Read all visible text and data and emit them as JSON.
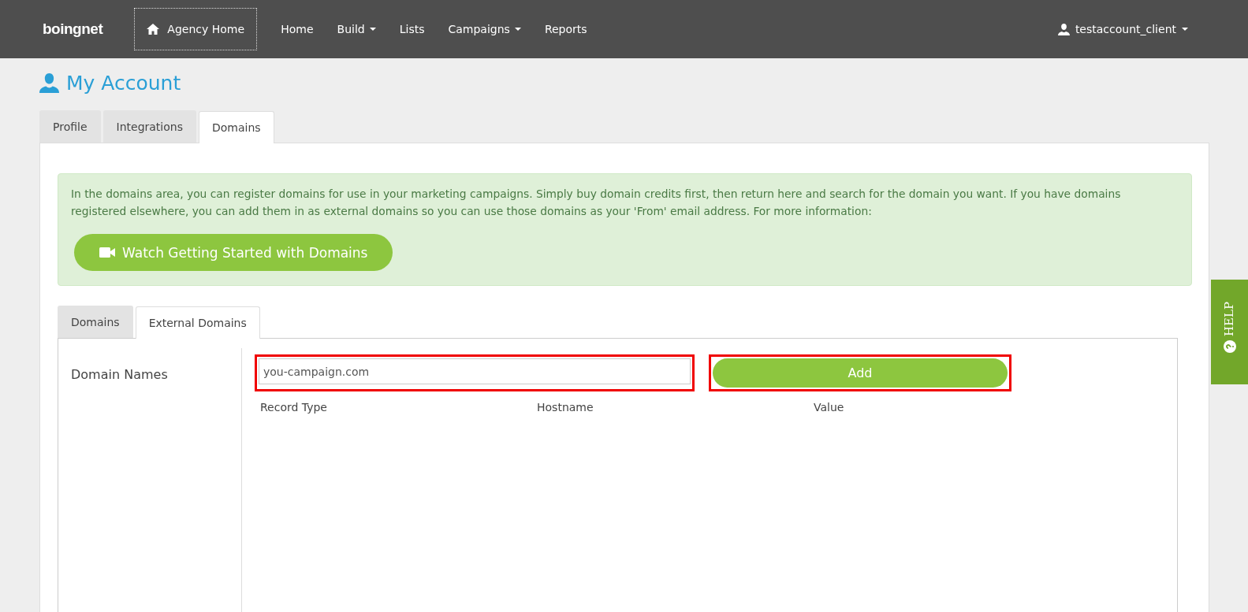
{
  "navbar": {
    "logo": "boingnet",
    "agency_home": "Agency Home",
    "items": [
      {
        "label": "Home",
        "dropdown": false
      },
      {
        "label": "Build",
        "dropdown": true
      },
      {
        "label": "Lists",
        "dropdown": false
      },
      {
        "label": "Campaigns",
        "dropdown": true
      },
      {
        "label": "Reports",
        "dropdown": false
      }
    ],
    "user": "testaccount_client"
  },
  "page_title": "My Account",
  "tabs": [
    {
      "label": "Profile",
      "selected": false
    },
    {
      "label": "Integrations",
      "selected": false
    },
    {
      "label": "Domains",
      "selected": true
    }
  ],
  "info_box": {
    "text": "In the domains area, you can register domains for use in your marketing campaigns. Simply buy domain credits first, then return here and search for the domain you want. If you have domains registered elsewhere, you can add them in as external domains so you can use those domains as your 'From' email address. For more information:",
    "button": "Watch Getting Started with Domains"
  },
  "sub_tabs": [
    {
      "label": "Domains",
      "selected": false
    },
    {
      "label": "External Domains",
      "selected": true
    }
  ],
  "form": {
    "label": "Domain Names",
    "domain_input": {
      "value": "you-campaign.com",
      "highlighted": true
    },
    "add_button": {
      "label": "Add",
      "highlighted": true
    },
    "columns": [
      "Record Type",
      "Hostname",
      "Value"
    ]
  },
  "help_tab": "HELP"
}
